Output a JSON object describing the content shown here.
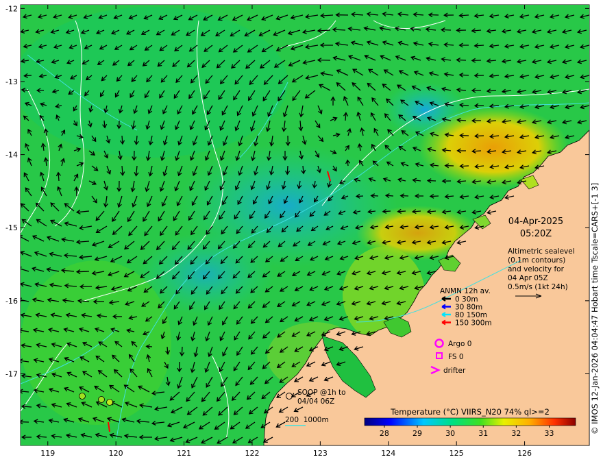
{
  "map": {
    "lon_ticks": [
      "119",
      "120",
      "121",
      "122",
      "123",
      "124",
      "125",
      "126"
    ],
    "lat_ticks": [
      "-12",
      "-13",
      "-14",
      "-15",
      "-16",
      "-17"
    ],
    "lon_range": [
      118.6,
      126.95
    ],
    "lat_range": [
      -11.95,
      -17.98
    ]
  },
  "timestamp": {
    "date": "04-Apr-2025",
    "time": "05:20Z"
  },
  "altimetry": {
    "line1": "Altimetric sealevel",
    "line2": "(0.1m contours)",
    "line3": "and velocity for",
    "line4": "04 Apr 05Z",
    "line5": "0.5m/s (1kt 24h)"
  },
  "anmn": {
    "title": "ANMN 12h av.",
    "entries": [
      {
        "label": "0 30m",
        "color": "#000000"
      },
      {
        "label": "30 80m",
        "color": "#0000ff"
      },
      {
        "label": "80 150m",
        "color": "#00e5ff"
      },
      {
        "label": "150 300m",
        "color": "#ff0000"
      }
    ]
  },
  "argo": {
    "label": "Argo 0",
    "color": "#ff00ff"
  },
  "fs": {
    "label": "FS 0",
    "color": "#ff00ff"
  },
  "drifter": {
    "label": "drifter",
    "color": "#ff00ff"
  },
  "soop": {
    "line1": "SOOP @1h to",
    "line2": "04/04 06Z"
  },
  "isobath": {
    "label": "200  1000m"
  },
  "colorbar": {
    "title": "Temperature (°C) VIIRS_N20 74% ql>=2",
    "ticks": [
      "28",
      "29",
      "30",
      "31",
      "32",
      "33"
    ],
    "range": [
      27.4,
      33.8
    ]
  },
  "credit": "© IMOS 12-Jan-2026 04:04:47 Hobart time Tscale=CARS+[-1 3]",
  "colors": {
    "land": "#f9c89a",
    "sea": "#20c040",
    "arrow": "#000000",
    "contour": "#ffffff",
    "isobath": "#40e0e0"
  }
}
